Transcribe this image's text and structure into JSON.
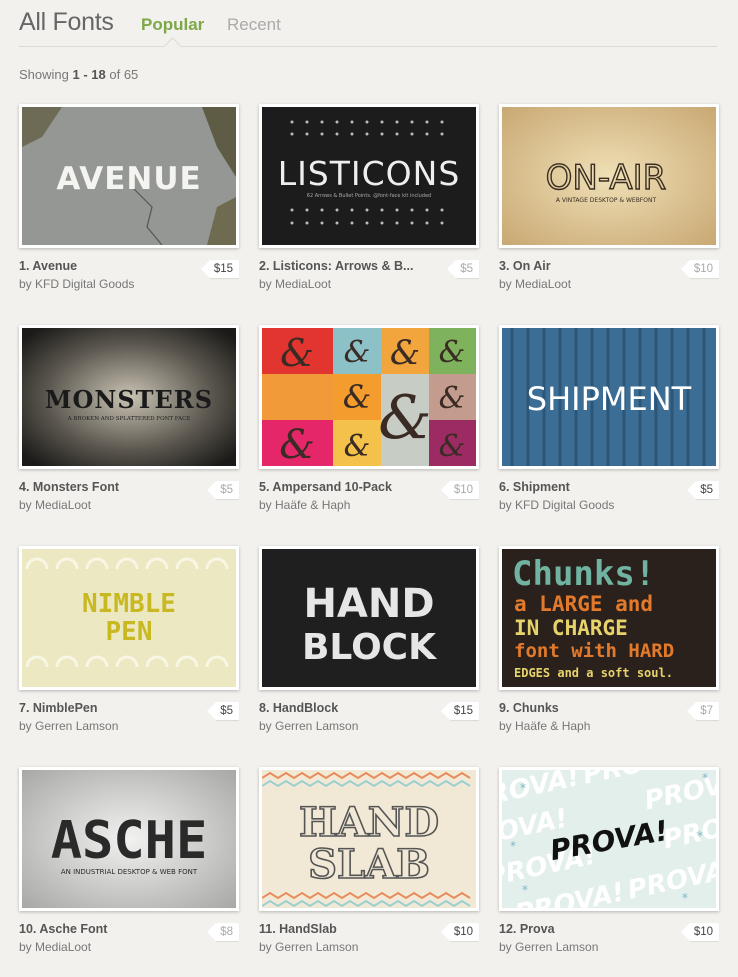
{
  "header": {
    "title": "All Fonts",
    "tabs": [
      {
        "label": "Popular",
        "active": true
      },
      {
        "label": "Recent",
        "active": false
      }
    ]
  },
  "results": {
    "prefix": "Showing ",
    "range": "1 - 18",
    "of_text": " of ",
    "total": "65"
  },
  "items": [
    {
      "title": "1. Avenue",
      "author": "by KFD Digital Goods",
      "price": "$15",
      "thumb_text": "AVENUE"
    },
    {
      "title": "2. Listicons: Arrows & B...",
      "author": "by MediaLoot",
      "price": "$5",
      "thumb_text": "LISTICONS",
      "thumb_sub": "62 Arrows & Bullet Points. @font-face kit included"
    },
    {
      "title": "3. On Air",
      "author": "by MediaLoot",
      "price": "$10",
      "thumb_text": "ON-AIR",
      "thumb_sub": "A VINTAGE DESKTOP & WEBFONT"
    },
    {
      "title": "4. Monsters Font",
      "author": "by MediaLoot",
      "price": "$5",
      "thumb_text": "MONSTERS",
      "thumb_sub": "A BROKEN AND SPLATTERED FONT FACE"
    },
    {
      "title": "5. Ampersand 10-Pack",
      "author": "by Haäfe & Haph",
      "price": "$10",
      "thumb_text": "&"
    },
    {
      "title": "6. Shipment",
      "author": "by KFD Digital Goods",
      "price": "$5",
      "thumb_text": "SHIPMENT"
    },
    {
      "title": "7. NimblePen",
      "author": "by Gerren Lamson",
      "price": "$5",
      "thumb_text": "NIMBLE",
      "thumb_text2": "PEN"
    },
    {
      "title": "8. HandBlock",
      "author": "by Gerren Lamson",
      "price": "$15",
      "thumb_text": "HAND",
      "thumb_text2": "BLOCK"
    },
    {
      "title": "9. Chunks",
      "author": "by Haäfe & Haph",
      "price": "$7",
      "thumb_text": "Chunks!"
    },
    {
      "title": "10. Asche Font",
      "author": "by MediaLoot",
      "price": "$8",
      "thumb_text": "ASCHE",
      "thumb_sub": "AN INDUSTRIAL DESKTOP & WEB FONT"
    },
    {
      "title": "11. HandSlab",
      "author": "by Gerren Lamson",
      "price": "$10",
      "thumb_text": "HAND",
      "thumb_text2": "SLAB"
    },
    {
      "title": "12. Prova",
      "author": "by Gerren Lamson",
      "price": "$10",
      "thumb_text": "PROVA!"
    }
  ],
  "chunks_lines": [
    "a LARGE and",
    "IN CHARGE",
    "font with HARD",
    "EDGES and a soft soul."
  ]
}
